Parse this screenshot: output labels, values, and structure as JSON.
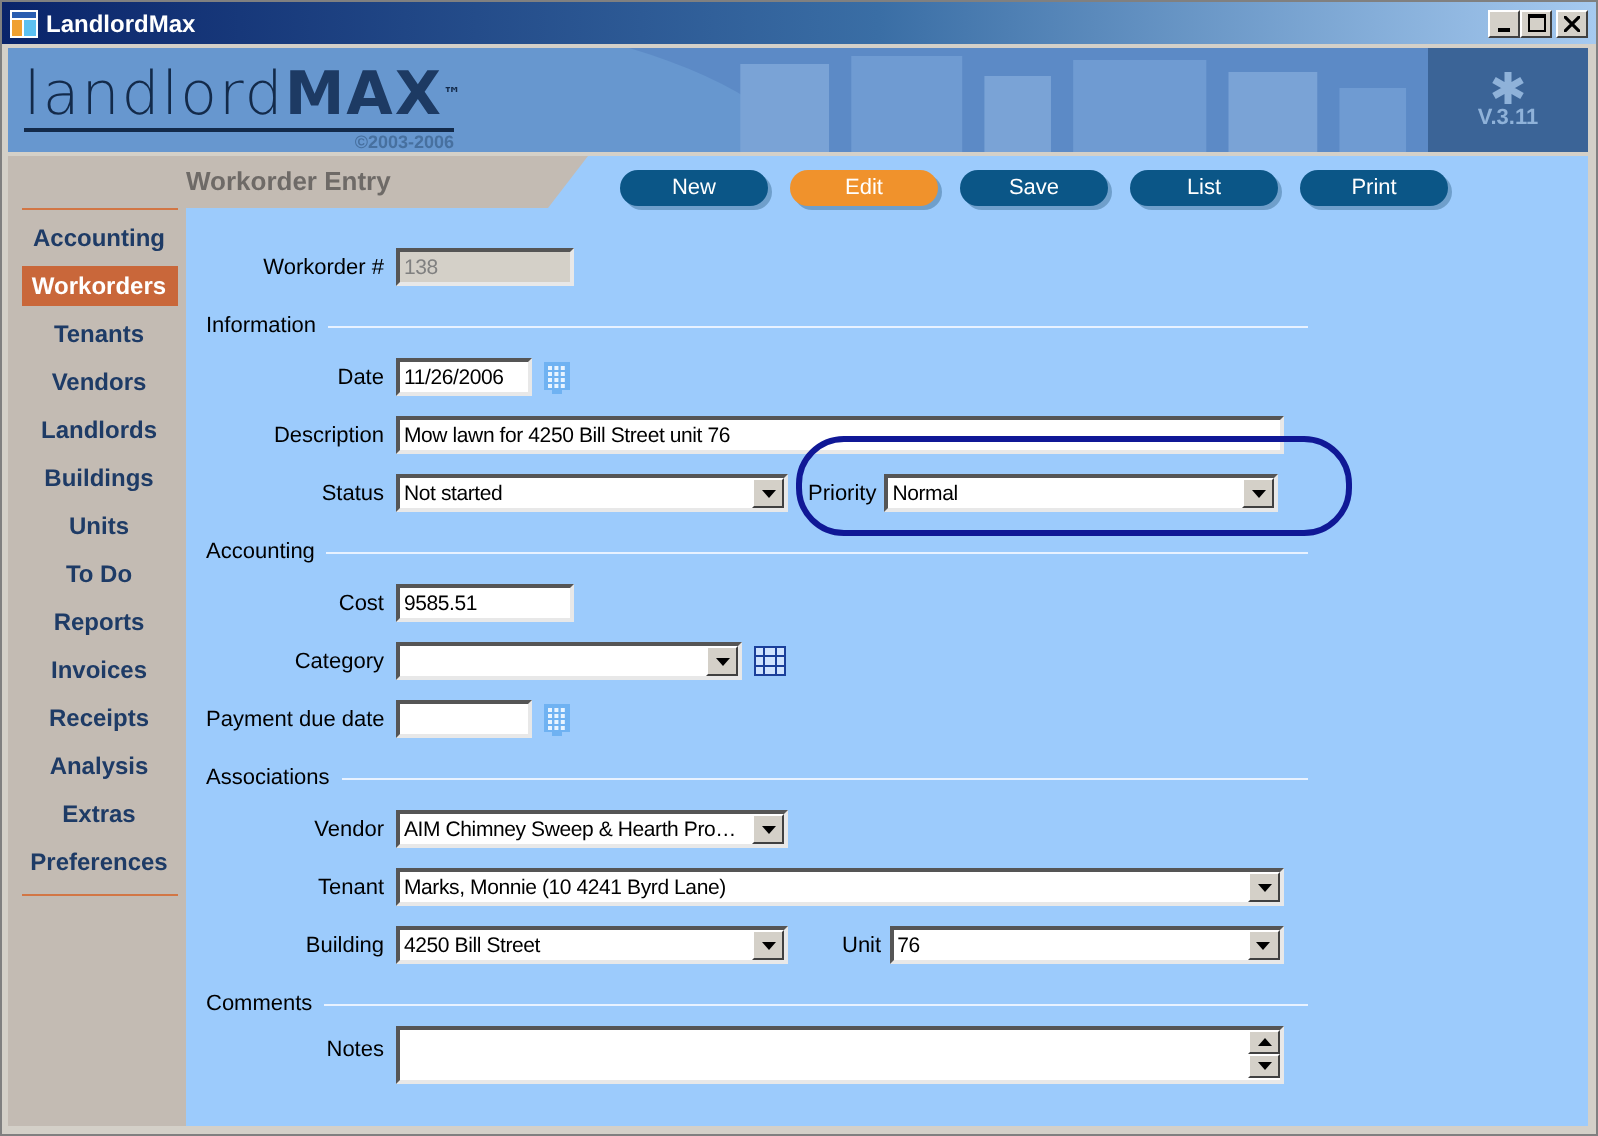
{
  "window": {
    "title": "LandlordMax"
  },
  "banner": {
    "logo_light": "landlord",
    "logo_bold": "MAX",
    "trademark": "™",
    "copyright": "©2003-2006",
    "version": "V.3.11"
  },
  "page_title": "Workorder Entry",
  "toolbar": [
    {
      "label": "New",
      "selected": false
    },
    {
      "label": "Edit",
      "selected": true
    },
    {
      "label": "Save",
      "selected": false
    },
    {
      "label": "List",
      "selected": false
    },
    {
      "label": "Print",
      "selected": false
    }
  ],
  "sidebar": {
    "items": [
      {
        "label": "Accounting",
        "selected": false
      },
      {
        "label": "Workorders",
        "selected": true
      },
      {
        "label": "Tenants",
        "selected": false
      },
      {
        "label": "Vendors",
        "selected": false
      },
      {
        "label": "Landlords",
        "selected": false
      },
      {
        "label": "Buildings",
        "selected": false
      },
      {
        "label": "Units",
        "selected": false
      },
      {
        "label": "To Do",
        "selected": false
      },
      {
        "label": "Reports",
        "selected": false
      },
      {
        "label": "Invoices",
        "selected": false
      },
      {
        "label": "Receipts",
        "selected": false
      },
      {
        "label": "Analysis",
        "selected": false
      },
      {
        "label": "Extras",
        "selected": false
      },
      {
        "label": "Preferences",
        "selected": false
      }
    ]
  },
  "form": {
    "workorder": {
      "label": "Workorder #",
      "kind": "text",
      "value": "138",
      "disabled": true
    },
    "information": {
      "title": "Information",
      "date": {
        "label": "Date",
        "kind": "date",
        "value": "11/26/2006",
        "disabled": false
      },
      "description": {
        "label": "Description",
        "kind": "text",
        "value": "Mow lawn for 4250 Bill Street unit 76",
        "disabled": false
      },
      "status": {
        "label": "Status",
        "kind": "select",
        "value": "Not started",
        "disabled": false
      },
      "priority": {
        "label": "Priority",
        "kind": "select",
        "value": "Normal",
        "disabled": false
      }
    },
    "accounting": {
      "title": "Accounting",
      "cost": {
        "label": "Cost",
        "kind": "text",
        "value": "9585.51",
        "disabled": false
      },
      "category": {
        "label": "Category",
        "kind": "select",
        "disabled": false
      },
      "payment_due_date": {
        "label": "Payment due date",
        "kind": "date",
        "disabled": false
      }
    },
    "associations": {
      "title": "Associations",
      "vendor": {
        "label": "Vendor",
        "kind": "select",
        "value": "AIM Chimney Sweep & Hearth Pro…",
        "disabled": false
      },
      "tenant": {
        "label": "Tenant",
        "kind": "select",
        "value": "Marks, Monnie (10 4241 Byrd Lane)",
        "disabled": false
      },
      "building": {
        "label": "Building",
        "kind": "select",
        "value": "4250 Bill Street",
        "disabled": false
      },
      "unit": {
        "label": "Unit",
        "kind": "select",
        "value": "76",
        "disabled": false
      }
    },
    "comments": {
      "title": "Comments",
      "notes": {
        "label": "Notes",
        "kind": "memo",
        "disabled": false
      }
    }
  }
}
